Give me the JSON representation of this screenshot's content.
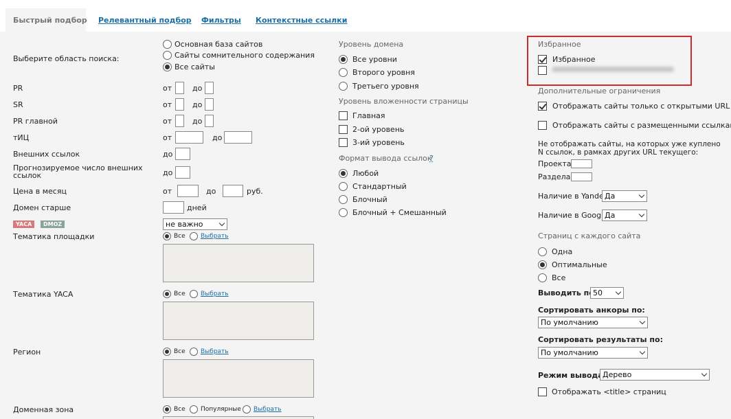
{
  "tabs": [
    {
      "label": "Быстрый подбор"
    },
    {
      "label": "Релевантный подбор"
    },
    {
      "label": "Фильтры"
    },
    {
      "label": "Контекстные ссылки"
    }
  ],
  "left": {
    "area_label": "Выберите область поиска:",
    "area_options": [
      "Основная база сайтов",
      "Сайты сомнительного содержания",
      "Все сайты"
    ],
    "area_selected": "Все сайты",
    "from": "от",
    "to": "до",
    "pr": "PR",
    "sr": "SR",
    "pr_main": "PR главной",
    "tic": "тИЦ",
    "ext_links": "Внешних ссылок",
    "forecast": "Прогнозируемое число внешних ссылок",
    "price": "Цена в месяц",
    "currency": "руб.",
    "domain_older": "Домен старше",
    "days": "дней",
    "tag_yaca": "YACA",
    "tag_dmoz": "DMOZ",
    "catalog_select": "не важно",
    "topic": "Тематика площадки",
    "topic_yaca": "Тематика YACA",
    "region": "Регион",
    "zone": "Доменная зона",
    "all": "Все",
    "choose": "Выбрать",
    "popular": "Популярные"
  },
  "middle": {
    "domain_level": "Уровень домена",
    "domain_options": [
      "Все уровни",
      "Второго уровня",
      "Третьего уровня"
    ],
    "domain_selected": "Все уровни",
    "nesting": "Уровень вложенности страницы",
    "nesting_options": [
      "Главная",
      "2-ой уровень",
      "3-ий уровень"
    ],
    "format": "Формат вывода ссылок",
    "format_help": "?",
    "format_options": [
      "Любой",
      "Стандартный",
      "Блочный",
      "Блочный + Смешанный"
    ],
    "format_selected": "Любой"
  },
  "right": {
    "favorites_title": "Избранное",
    "favorites_item": "Избранное",
    "extra": "Дополнительные ограничения",
    "only_open": "Отображать сайты только с открытыми URL",
    "with_links": "Отображать сайты с размещенными ссылками",
    "bought_note": "Не отображать сайты, на которых уже куплено N ссылок, в рамках других URL текущего:",
    "project": "Проекта",
    "section": "Раздела",
    "yandex": "Наличие в Yandex",
    "yandex_value": "Да",
    "google": "Наличие в Google",
    "google_value": "Да",
    "pages": "Страниц с каждого сайта",
    "pages_options": [
      "Одна",
      "Оптимальные",
      "Все"
    ],
    "pages_selected": "Оптимальные",
    "show_by": "Выводить по:",
    "show_by_value": "50",
    "sort_anchors": "Сортировать анкоры по:",
    "sort_anchors_value": "По умолчанию",
    "sort_results": "Сортировать результаты по:",
    "sort_results_value": "По умолчанию",
    "mode": "Режим вывода:",
    "mode_value": "Дерево",
    "show_title": "Отображать <title> страниц"
  },
  "colors": {
    "accent": "#1a6fa8",
    "highlight": "#cc2b2b",
    "yaca": "#d77a7a",
    "dmoz": "#8aa39b"
  }
}
